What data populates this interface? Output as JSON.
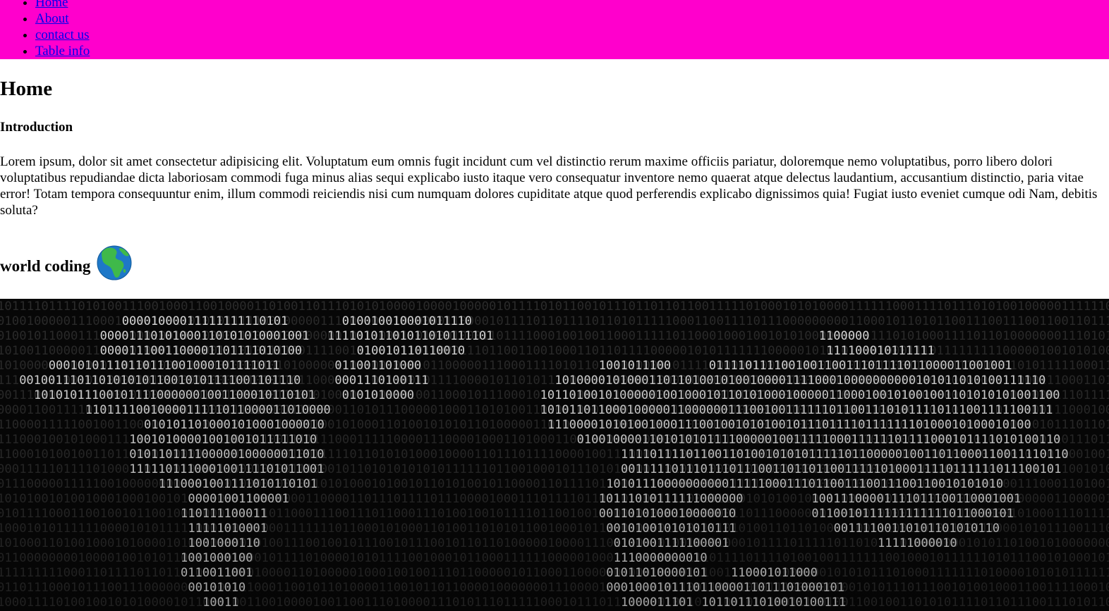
{
  "nav": {
    "items": [
      {
        "label": "Home"
      },
      {
        "label": "About"
      },
      {
        "label": "contact us"
      },
      {
        "label": "Table info"
      }
    ]
  },
  "main": {
    "title": "Home",
    "section_heading": "Introduction",
    "intro": "Lorem ipsum, dolor sit amet consectetur adipisicing elit. Voluptatum eum omnis fugit incidunt cum vel distinctio rerum maxime officiis pariatur, doloremque nemo voluptatibus, porro libero dolori voluptatibus repudiandae dicta laboriosam commodi fuga minus alias sequi explicabo iusto itaque vero consequatur inventore nemo quaerat atque delectus laudantium, accusantium distinctio, paria vitae error! Totam tempora consequuntur enim, illum commodi reiciendis nisi cum numquam dolores cupiditate atque quod perferendis explicabo dignissimos quia! Fugiat iusto eveniet cumque odi Nam, debitis soluta?",
    "world_heading": "world coding",
    "world_icon": "globe-africa-icon"
  },
  "colors": {
    "nav_background": "#ff00cc",
    "link": "#0000ee",
    "image_background": "#070707"
  }
}
